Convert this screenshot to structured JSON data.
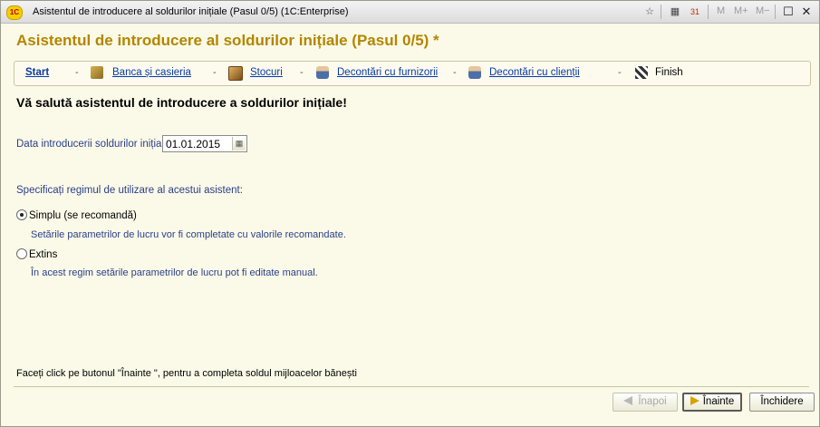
{
  "window": {
    "title": "Asistentul de introducere al soldurilor inițiale (Pasul 0/5)",
    "app_name": "(1C:Enterprise)",
    "logo_text": "1С",
    "toolbar_m": [
      "M",
      "M+",
      "M−"
    ],
    "calendar_icon_text": "31"
  },
  "page": {
    "title": "Asistentul de introducere al soldurilor inițiale (Pasul 0/5) *",
    "welcome": "Vă salută asistentul de introducere a soldurilor inițiale!"
  },
  "steps": [
    {
      "label": "Start",
      "icon": "none"
    },
    {
      "label": "Banca și casieria",
      "icon": "bank-icon"
    },
    {
      "label": "Stocuri",
      "icon": "stock-icon"
    },
    {
      "label": "Decontări cu furnizorii",
      "icon": "supplier-icon"
    },
    {
      "label": "Decontări cu clienții",
      "icon": "client-icon"
    },
    {
      "label": "Finish",
      "icon": "finish-flag-icon"
    }
  ],
  "date": {
    "label": "Data introducerii soldurilor inițiale:",
    "value": "01.01.2015"
  },
  "mode": {
    "label": "Specificați regimul de utilizare al acestui asistent:",
    "options": [
      {
        "label": "Simplu (se recomandă)",
        "description": "Setările parametrilor de lucru vor fi completate cu valorile recomandate.",
        "checked": true
      },
      {
        "label": "Extins",
        "description": "În acest regim setările parametrilor de lucru pot fi editate manual.",
        "checked": false
      }
    ]
  },
  "hint": "Faceți click pe butonul \"Înainte \", pentru a completa soldul mijloacelor bănești",
  "buttons": {
    "back": "Înapoi",
    "next": "Înainte",
    "close": "Închidere"
  },
  "colors": {
    "title": "#b38600",
    "link": "#0a3aa8",
    "label": "#2a3f8a",
    "background": "#fbfae8"
  }
}
